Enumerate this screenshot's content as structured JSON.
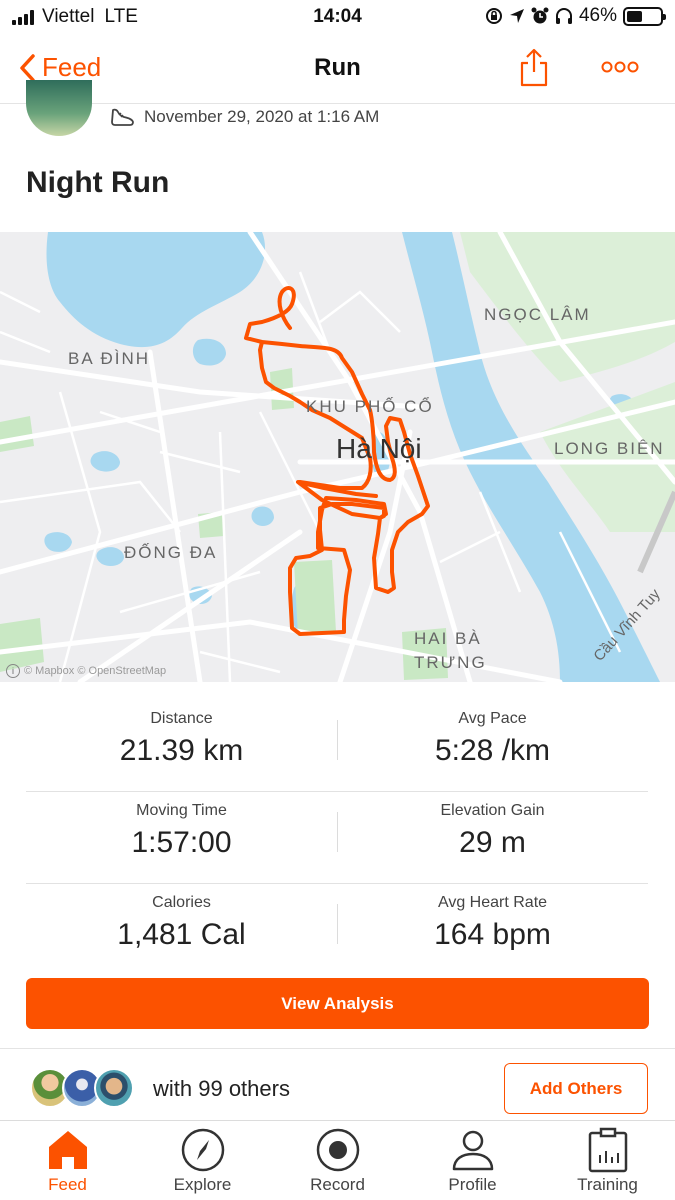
{
  "status_bar": {
    "carrier": "Viettel",
    "network": "LTE",
    "time": "14:04",
    "battery": "46%",
    "battery_level": 0.46
  },
  "nav": {
    "back_label": "Feed",
    "title": "Run"
  },
  "activity": {
    "date": "November 29, 2020 at 1:16 AM",
    "title": "Night Run"
  },
  "map": {
    "labels": {
      "ba_dinh": "BA ĐÌNH",
      "ngoc_lam": "NGỌC LÂM",
      "khu_pho_co": "KHU PHỐ CỔ",
      "ha_noi": "Hà Nội",
      "long_bien": "LONG BIÊN",
      "dong_da": "ĐỐNG ĐA",
      "hai_ba": "HAI BÀ",
      "trung": "TRƯNG",
      "bridge": "Cầu Vĩnh Tuy"
    },
    "attribution": "© Mapbox © OpenStreetMap",
    "route_color": "#fc5200",
    "water_color": "#a8d8f0",
    "park_color": "#c9e8c4"
  },
  "stats": [
    {
      "label": "Distance",
      "value": "21.39 km"
    },
    {
      "label": "Avg Pace",
      "value": "5:28 /km"
    },
    {
      "label": "Moving Time",
      "value": "1:57:00"
    },
    {
      "label": "Elevation Gain",
      "value": "29 m"
    },
    {
      "label": "Calories",
      "value": "1,481 Cal"
    },
    {
      "label": "Avg Heart Rate",
      "value": "164 bpm"
    }
  ],
  "analysis_button": "View Analysis",
  "group": {
    "with_text": "with 99 others",
    "add_button": "Add Others"
  },
  "tabs": [
    {
      "label": "Feed",
      "icon": "home-icon",
      "active": true
    },
    {
      "label": "Explore",
      "icon": "compass-icon",
      "active": false
    },
    {
      "label": "Record",
      "icon": "record-icon",
      "active": false
    },
    {
      "label": "Profile",
      "icon": "profile-icon",
      "active": false
    },
    {
      "label": "Training",
      "icon": "calendar-icon",
      "active": false
    }
  ],
  "colors": {
    "accent": "#fc5200"
  }
}
